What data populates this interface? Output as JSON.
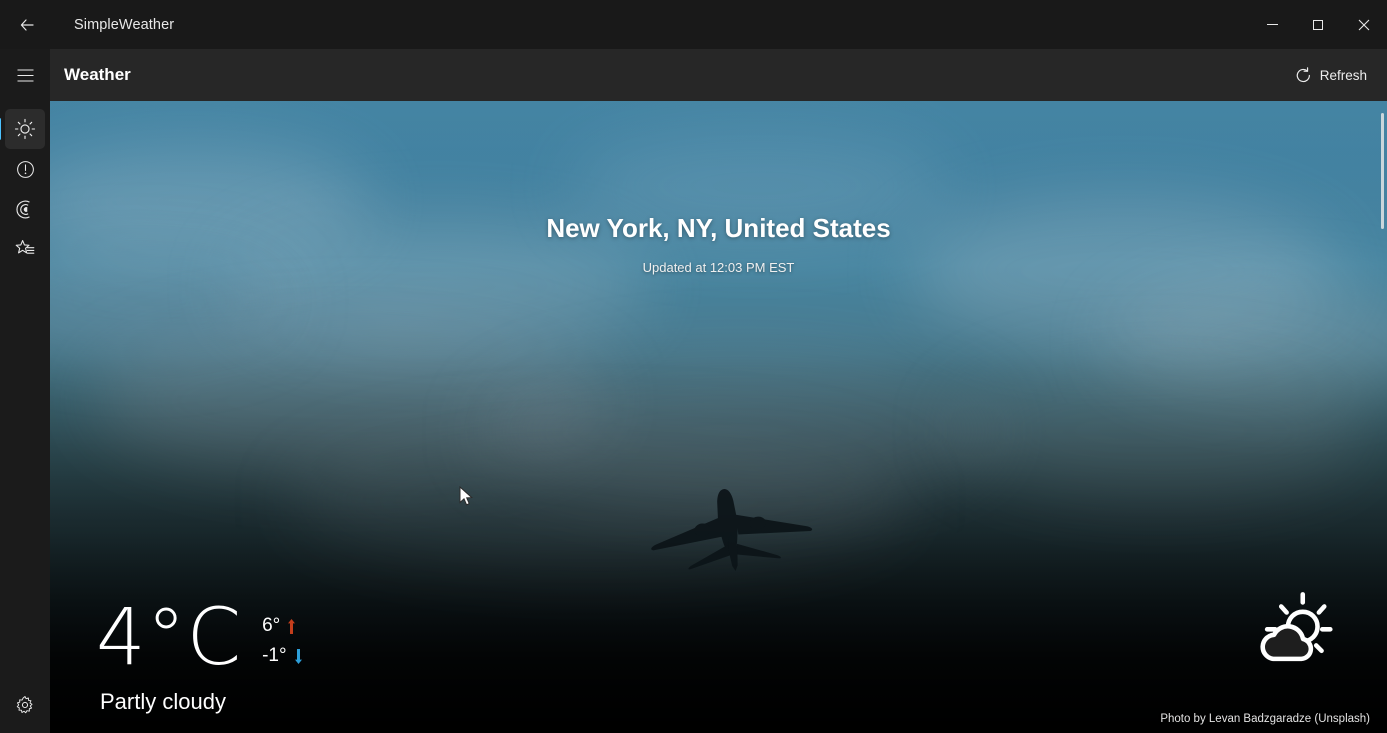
{
  "window": {
    "app_title": "SimpleWeather",
    "back_icon": "back-arrow-icon",
    "minimize_label": "Minimize",
    "maximize_label": "Maximize",
    "close_label": "Close"
  },
  "rail": {
    "menu_label": "Menu",
    "items": [
      {
        "id": "weather",
        "icon": "sun-icon",
        "label": "Weather",
        "selected": true
      },
      {
        "id": "alerts",
        "icon": "alert-circle-icon",
        "label": "Alerts",
        "selected": false
      },
      {
        "id": "radar",
        "icon": "radar-icon",
        "label": "Radar",
        "selected": false
      },
      {
        "id": "favorites",
        "icon": "star-list-icon",
        "label": "Favorites",
        "selected": false
      }
    ],
    "settings": {
      "icon": "gear-icon",
      "label": "Settings"
    }
  },
  "header": {
    "title": "Weather",
    "refresh_label": "Refresh",
    "refresh_icon": "refresh-icon"
  },
  "weather": {
    "location": "New York, NY, United States",
    "updated": "Updated at 12:03 PM EST",
    "temperature": "4°C",
    "high": "6°",
    "low": "-1°",
    "high_arrow_icon": "arrow-up-icon",
    "low_arrow_icon": "arrow-down-icon",
    "condition": "Partly cloudy",
    "condition_icon": "sun-behind-cloud-icon",
    "photo_credit": "Photo by Levan Badzgaradze (Unsplash)",
    "background_icon": "airplane-silhouette"
  },
  "colors": {
    "accent": "#4cc2ff",
    "high_arrow": "#c43e1c",
    "low_arrow": "#2d9fd9",
    "titlebar_bg": "#191919",
    "subheader_bg": "#272727"
  }
}
